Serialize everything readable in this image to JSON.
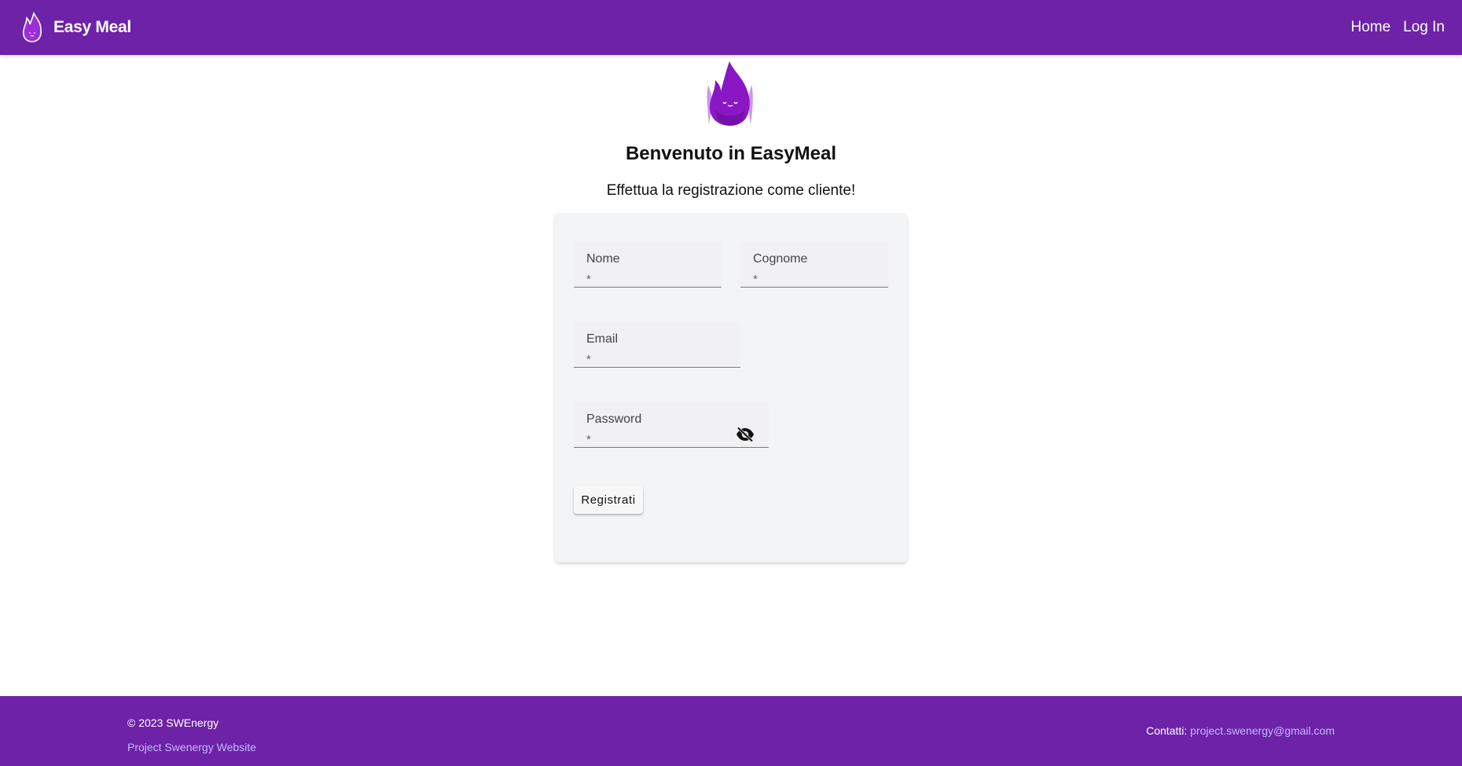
{
  "header": {
    "brand": "Easy Meal",
    "nav": [
      {
        "label": "Home"
      },
      {
        "label": "Log In"
      }
    ]
  },
  "hero": {
    "title": "Benvenuto in EasyMeal",
    "subtitle": "Effettua la registrazione come cliente!"
  },
  "form": {
    "nome": {
      "label": "Nome",
      "required": "*",
      "value": ""
    },
    "cognome": {
      "label": "Cognome",
      "required": "*",
      "value": ""
    },
    "email": {
      "label": "Email",
      "required": "*",
      "value": ""
    },
    "password": {
      "label": "Password",
      "required": "*",
      "value": ""
    },
    "submit_label": "Registrati"
  },
  "footer": {
    "copyright": "© 2023 SWEnergy",
    "website_link": "Project Swenergy Website",
    "contacts_label": "Contatti:",
    "contacts_email": "project.swenergy@gmail.com"
  },
  "colors": {
    "brand": "#6d22a7",
    "link": "#c7b8ff",
    "card_bg": "#f3f4f6"
  },
  "icons": {
    "logo": "purple-flame-mascot-icon",
    "password_toggle": "eye-off-icon"
  }
}
